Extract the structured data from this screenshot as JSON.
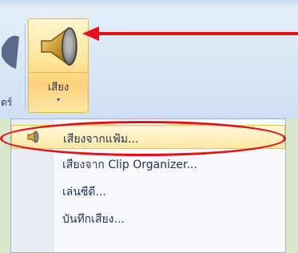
{
  "ribbon": {
    "previous_button_label": "ดร์",
    "sound_button": {
      "label": "เสียง",
      "dropdown_arrow": "▾",
      "icon": "speaker-icon"
    }
  },
  "menu": {
    "items": [
      {
        "label": "เสียงจากแฟ้ม...",
        "icon": "speaker-icon",
        "highlighted": true
      },
      {
        "label": "เสียงจาก Clip Organizer...",
        "icon": "",
        "highlighted": false
      },
      {
        "label": "เล่นซีดี...",
        "icon": "",
        "highlighted": false
      },
      {
        "label": "บันทึกเสียง...",
        "icon": "",
        "highlighted": false
      }
    ]
  },
  "colors": {
    "annotation_red": "#e2111a",
    "highlight_fill": "#ffe8a6",
    "ribbon_fill": "#dbe8f7",
    "background": "#d8e8cb"
  }
}
